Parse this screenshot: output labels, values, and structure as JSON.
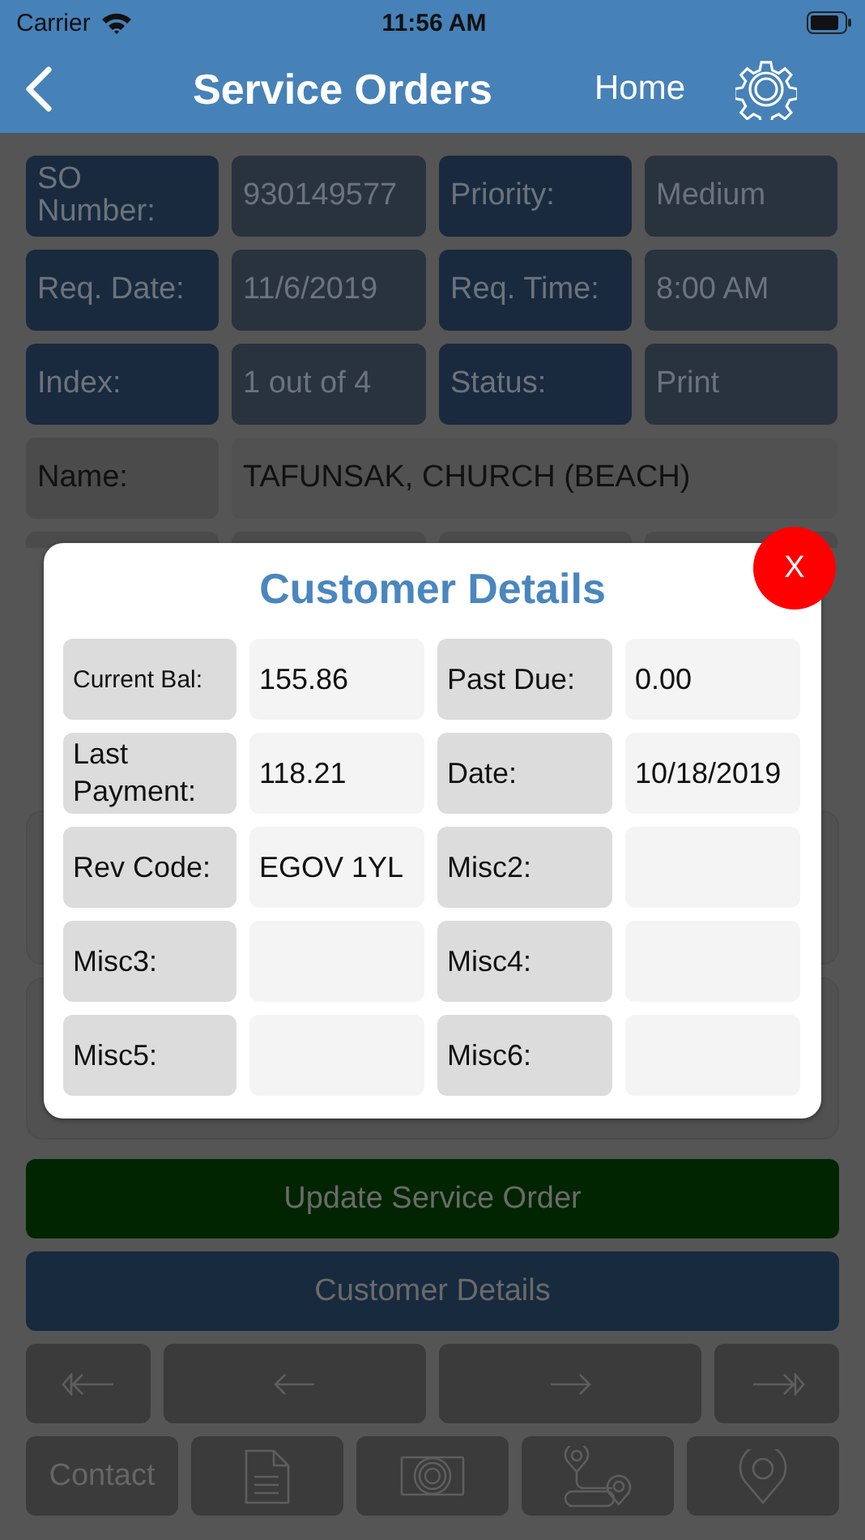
{
  "status_bar": {
    "carrier": "Carrier",
    "time": "11:56 AM"
  },
  "nav_bar": {
    "title": "Service Orders",
    "home": "Home"
  },
  "fields": [
    {
      "label": "SO Number:",
      "value": "930149577"
    },
    {
      "label": "Priority:",
      "value": "Medium"
    },
    {
      "label": "Req. Date:",
      "value": "11/6/2019"
    },
    {
      "label": "Req. Time:",
      "value": "8:00 AM"
    },
    {
      "label": "Index:",
      "value": "1 out of 4"
    },
    {
      "label": "Status:",
      "value": "Print"
    }
  ],
  "name_row": {
    "label": "Name:",
    "value": "TAFUNSAK, CHURCH (BEACH)"
  },
  "buttons": [
    {
      "kind": "update",
      "label": "Update Service Order"
    },
    {
      "kind": "details",
      "label": "Customer Details"
    }
  ],
  "contact_button": {
    "label": "Contact"
  },
  "modal": {
    "title": "Customer Details",
    "close": "X",
    "fields": [
      {
        "label": "Current Bal:",
        "value": "155.86"
      },
      {
        "label": "Past Due:",
        "value": "0.00"
      },
      {
        "label": "Last Payment:",
        "value": "118.21"
      },
      {
        "label": "Date:",
        "value": "10/18/2019"
      },
      {
        "label": "Rev Code:",
        "value": "EGOV 1YL"
      },
      {
        "label": "Misc2:"
      },
      {
        "label": "Misc3:"
      },
      {
        "label": "Misc4:"
      },
      {
        "label": "Misc5:"
      },
      {
        "label": "Misc6:"
      }
    ]
  }
}
